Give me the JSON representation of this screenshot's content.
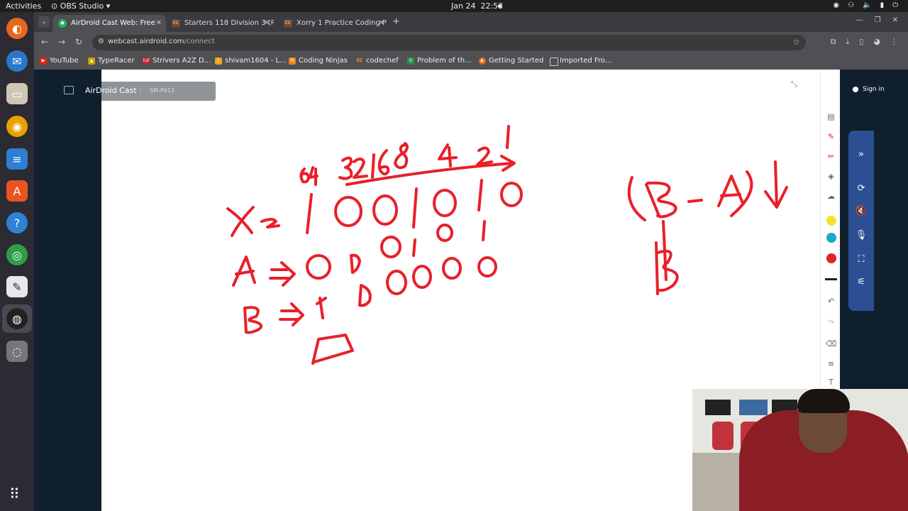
{
  "system_bar": {
    "activities": "Activities",
    "app_menu": "OBS Studio",
    "date": "Jan 24",
    "time": "22:53"
  },
  "browser": {
    "tabs": [
      {
        "label": "AirDroid Cast Web: Free",
        "active": true
      },
      {
        "label": "Starters 118 Division 3 (R",
        "active": false
      },
      {
        "label": "Xorry 1 Practice Coding P",
        "active": false
      }
    ],
    "url_host": "webcast.airdroid.com",
    "url_path": "/connect",
    "bookmarks": [
      "YouTube",
      "TypeRacer",
      "Strivers A2Z D...",
      "shivam1604 - L...",
      "Coding Ninjas",
      "codechef",
      "Problem of th...",
      "Getting Started",
      "Imported Fro..."
    ]
  },
  "app": {
    "brand": "AirDroid Cast",
    "separator": "|",
    "device": "SM-P613",
    "sign_in": "Sign in"
  },
  "whiteboard": {
    "place_values": "64 32 16 8 4 2 1",
    "x_row": "X = 1 0 0 1 0 1 0",
    "a_row": "A => 0 0 0 1 0 1",
    "b_row": "B => 1 0 0 0 0 0",
    "formula": "(B - A) ↓",
    "result": "B",
    "ink_color": "#e8202a"
  },
  "colors": {
    "page_bg": "#0f1f2d",
    "float_bar": "#2c4e92",
    "pen_yellow": "#f3e22e",
    "pen_cyan": "#1fa7c9",
    "pen_red": "#e8202a"
  }
}
